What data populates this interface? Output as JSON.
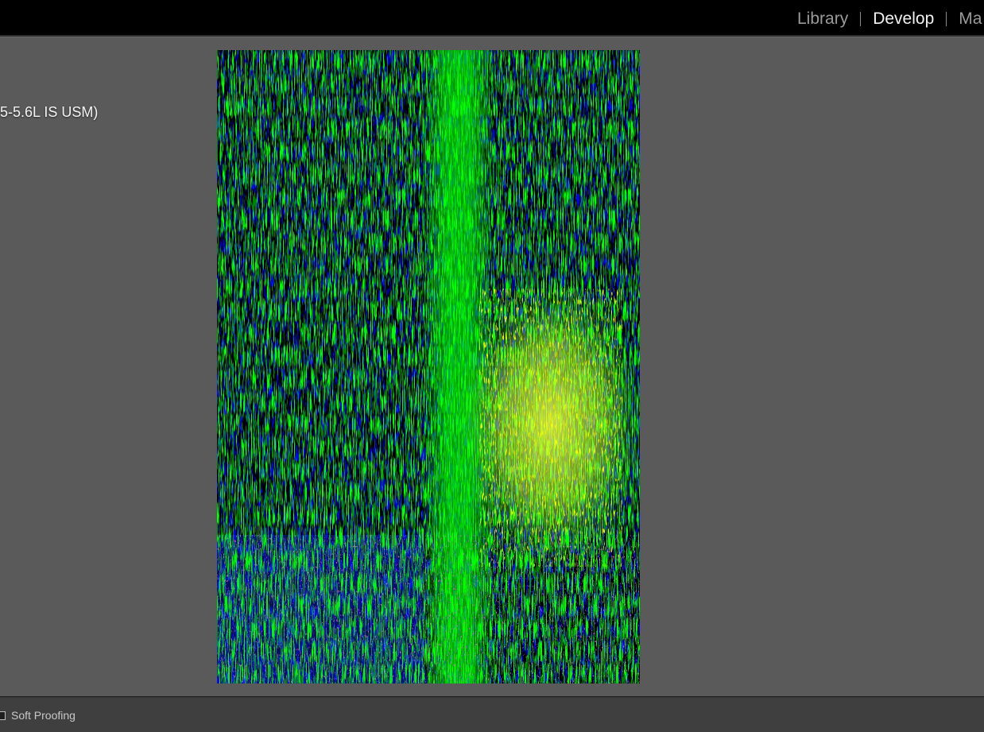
{
  "modules": {
    "items": [
      {
        "label": "Library",
        "active": false
      },
      {
        "label": "Develop",
        "active": true
      },
      {
        "label": "Ma",
        "active": false
      }
    ]
  },
  "photo_info": {
    "lens_text": "5-5.6L IS USM)"
  },
  "toolbar": {
    "soft_proofing_label": "Soft Proofing",
    "soft_proofing_checked": false
  },
  "colors": {
    "panel_bg": "#5a5a5a",
    "module_bar_bg": "#000000",
    "toolbar_bg": "#3f3f3f",
    "active_module": "#f2f2f2",
    "inactive_module": "#9a9a9a"
  }
}
